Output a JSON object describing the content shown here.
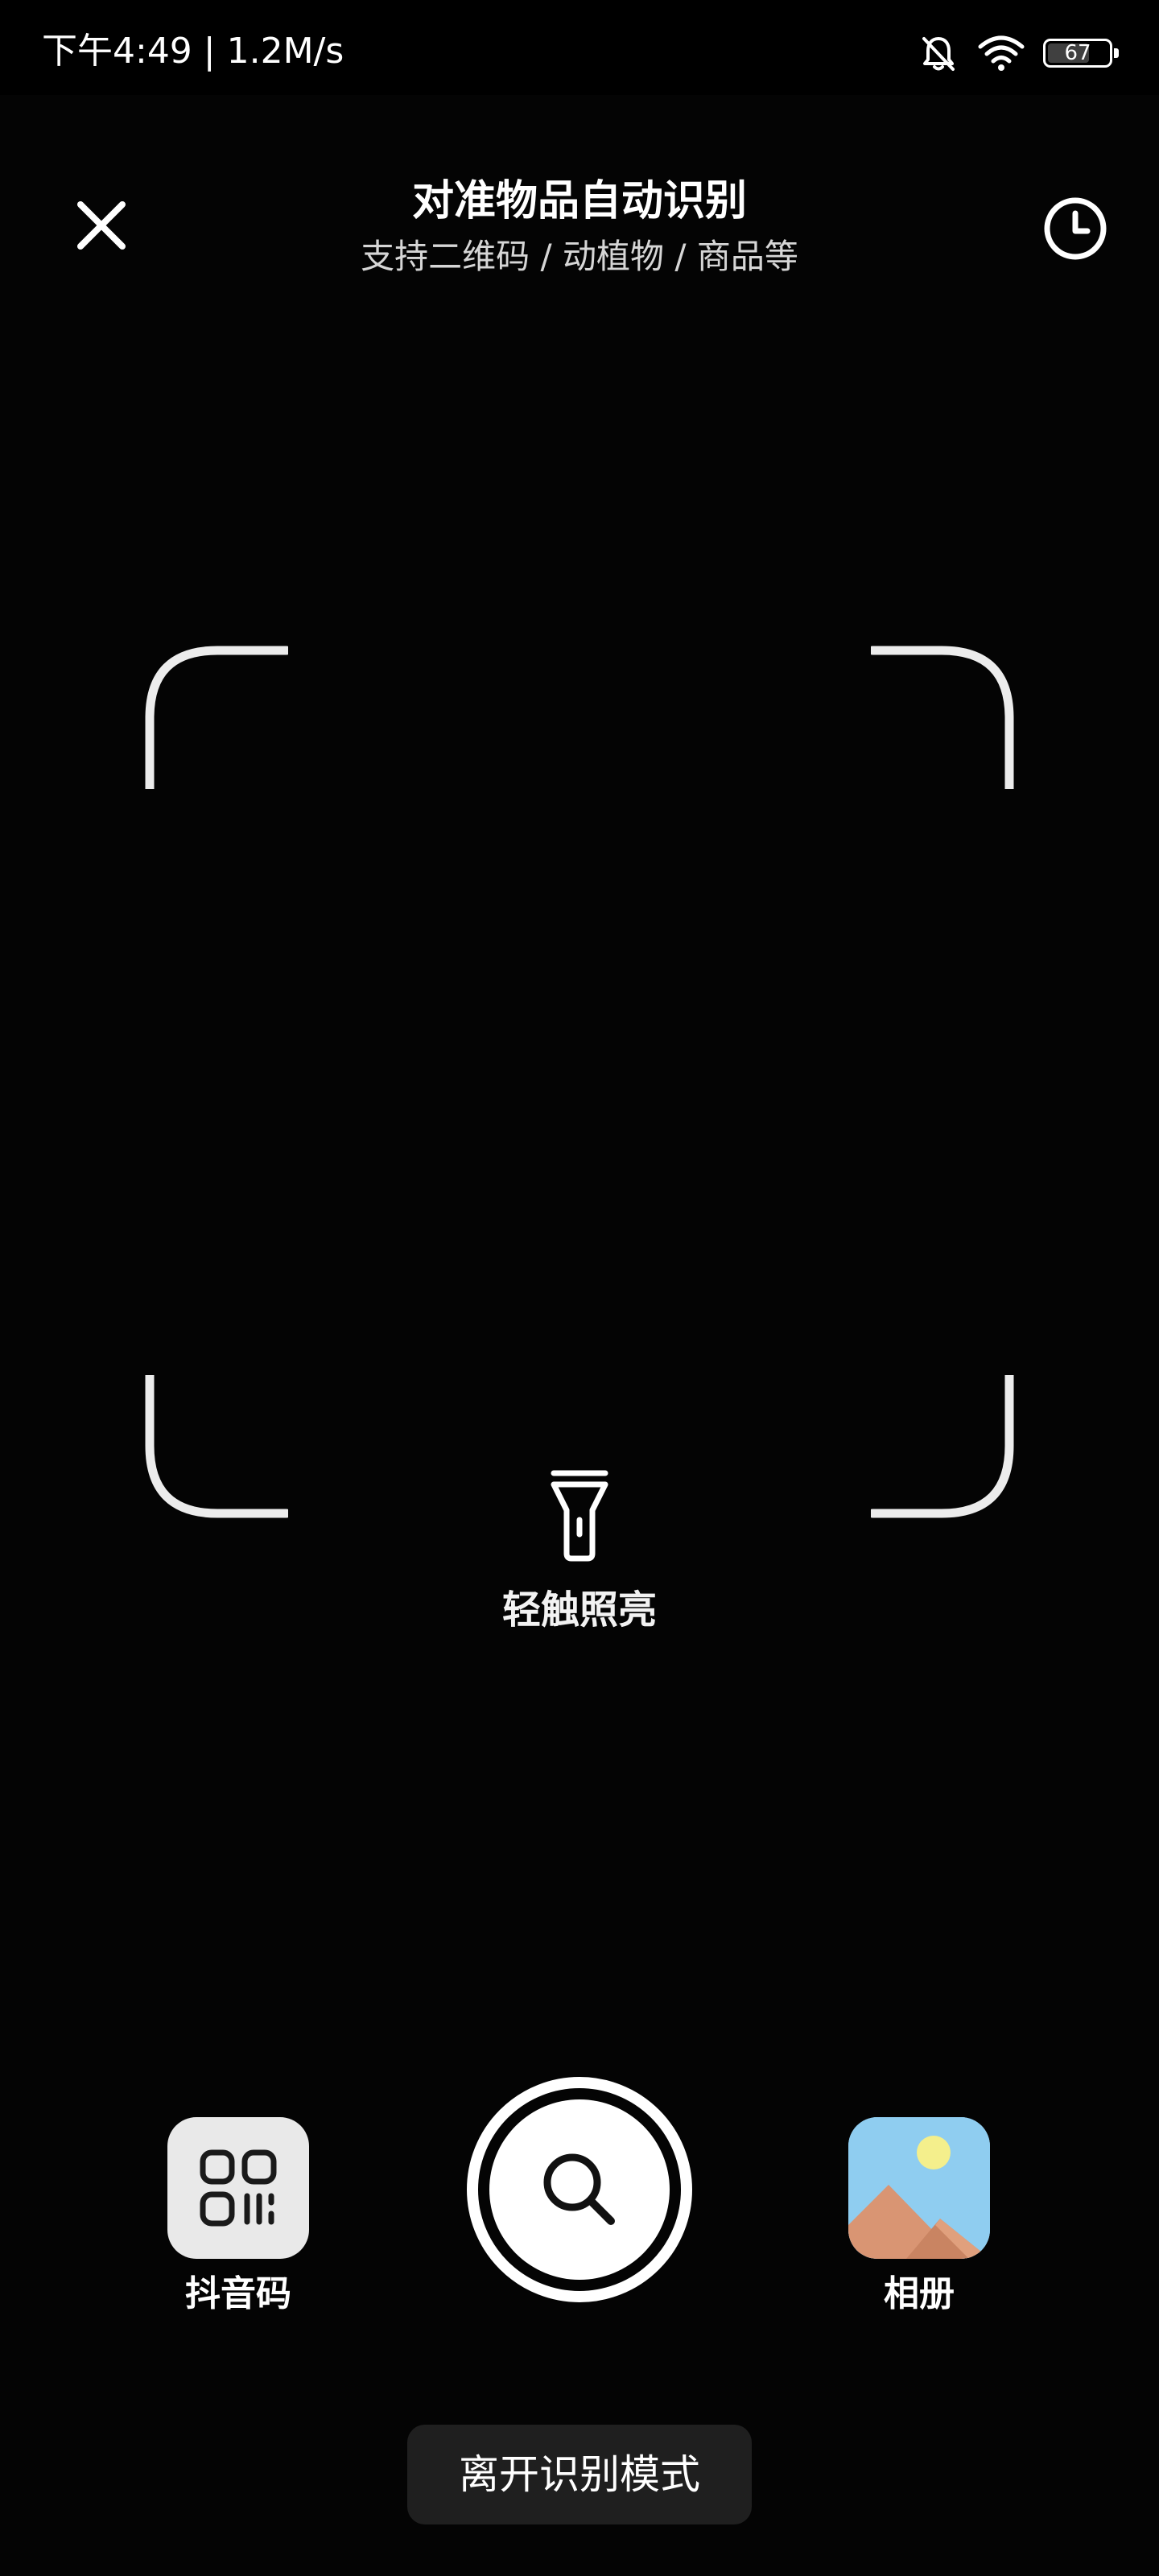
{
  "status_bar": {
    "time_speed": "下午4:49 | 1.2M/s",
    "battery_level": "67",
    "icons": [
      "bell-muted-icon",
      "wifi-icon",
      "battery-icon"
    ]
  },
  "header": {
    "title": "对准物品自动识别",
    "subtitle": "支持二维码 / 动植物 / 商品等",
    "close_icon": "close-icon",
    "history_icon": "clock-icon"
  },
  "scanner": {
    "frame": "scan-frame",
    "flashlight_icon": "flashlight-icon",
    "flashlight_label": "轻触照亮"
  },
  "bottom_controls": {
    "left_button": {
      "label": "抖音码",
      "icon": "qr-code-icon"
    },
    "center_button": {
      "icon": "search-icon"
    },
    "right_button": {
      "label": "相册",
      "icon": "album-icon"
    }
  },
  "footer": {
    "exit_label": "离开识别模式"
  },
  "colors": {
    "background": "#040404",
    "text": "#ffffff",
    "subtitle": "#d6d6d6",
    "exit_button_bg": "#1f1f1f",
    "qr_tile_bg": "#e9e9e9",
    "sky": "#8fcdf0",
    "sun": "#f4ef8c",
    "mountain": "#d99573"
  }
}
